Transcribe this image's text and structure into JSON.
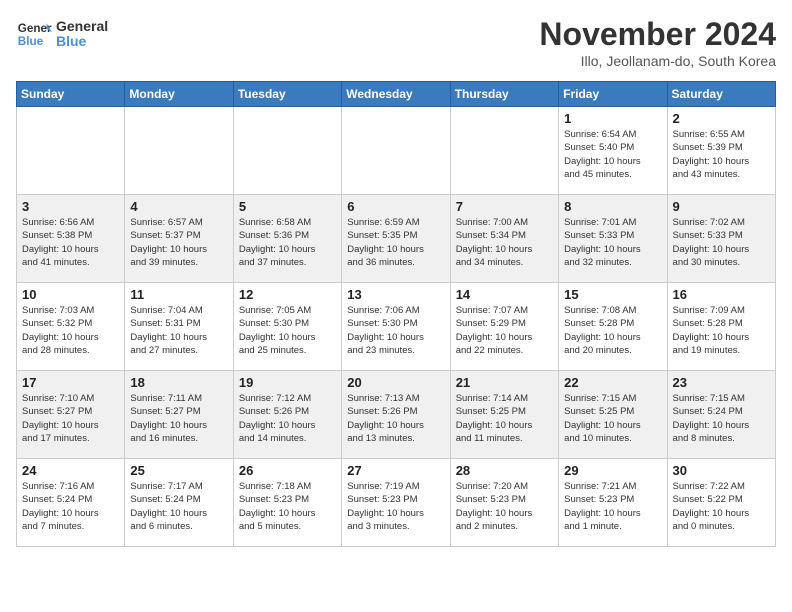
{
  "header": {
    "logo_line1": "General",
    "logo_line2": "Blue",
    "month": "November 2024",
    "location": "Illo, Jeollanam-do, South Korea"
  },
  "weekdays": [
    "Sunday",
    "Monday",
    "Tuesday",
    "Wednesday",
    "Thursday",
    "Friday",
    "Saturday"
  ],
  "weeks": [
    [
      {
        "day": "",
        "info": ""
      },
      {
        "day": "",
        "info": ""
      },
      {
        "day": "",
        "info": ""
      },
      {
        "day": "",
        "info": ""
      },
      {
        "day": "",
        "info": ""
      },
      {
        "day": "1",
        "info": "Sunrise: 6:54 AM\nSunset: 5:40 PM\nDaylight: 10 hours\nand 45 minutes."
      },
      {
        "day": "2",
        "info": "Sunrise: 6:55 AM\nSunset: 5:39 PM\nDaylight: 10 hours\nand 43 minutes."
      }
    ],
    [
      {
        "day": "3",
        "info": "Sunrise: 6:56 AM\nSunset: 5:38 PM\nDaylight: 10 hours\nand 41 minutes."
      },
      {
        "day": "4",
        "info": "Sunrise: 6:57 AM\nSunset: 5:37 PM\nDaylight: 10 hours\nand 39 minutes."
      },
      {
        "day": "5",
        "info": "Sunrise: 6:58 AM\nSunset: 5:36 PM\nDaylight: 10 hours\nand 37 minutes."
      },
      {
        "day": "6",
        "info": "Sunrise: 6:59 AM\nSunset: 5:35 PM\nDaylight: 10 hours\nand 36 minutes."
      },
      {
        "day": "7",
        "info": "Sunrise: 7:00 AM\nSunset: 5:34 PM\nDaylight: 10 hours\nand 34 minutes."
      },
      {
        "day": "8",
        "info": "Sunrise: 7:01 AM\nSunset: 5:33 PM\nDaylight: 10 hours\nand 32 minutes."
      },
      {
        "day": "9",
        "info": "Sunrise: 7:02 AM\nSunset: 5:33 PM\nDaylight: 10 hours\nand 30 minutes."
      }
    ],
    [
      {
        "day": "10",
        "info": "Sunrise: 7:03 AM\nSunset: 5:32 PM\nDaylight: 10 hours\nand 28 minutes."
      },
      {
        "day": "11",
        "info": "Sunrise: 7:04 AM\nSunset: 5:31 PM\nDaylight: 10 hours\nand 27 minutes."
      },
      {
        "day": "12",
        "info": "Sunrise: 7:05 AM\nSunset: 5:30 PM\nDaylight: 10 hours\nand 25 minutes."
      },
      {
        "day": "13",
        "info": "Sunrise: 7:06 AM\nSunset: 5:30 PM\nDaylight: 10 hours\nand 23 minutes."
      },
      {
        "day": "14",
        "info": "Sunrise: 7:07 AM\nSunset: 5:29 PM\nDaylight: 10 hours\nand 22 minutes."
      },
      {
        "day": "15",
        "info": "Sunrise: 7:08 AM\nSunset: 5:28 PM\nDaylight: 10 hours\nand 20 minutes."
      },
      {
        "day": "16",
        "info": "Sunrise: 7:09 AM\nSunset: 5:28 PM\nDaylight: 10 hours\nand 19 minutes."
      }
    ],
    [
      {
        "day": "17",
        "info": "Sunrise: 7:10 AM\nSunset: 5:27 PM\nDaylight: 10 hours\nand 17 minutes."
      },
      {
        "day": "18",
        "info": "Sunrise: 7:11 AM\nSunset: 5:27 PM\nDaylight: 10 hours\nand 16 minutes."
      },
      {
        "day": "19",
        "info": "Sunrise: 7:12 AM\nSunset: 5:26 PM\nDaylight: 10 hours\nand 14 minutes."
      },
      {
        "day": "20",
        "info": "Sunrise: 7:13 AM\nSunset: 5:26 PM\nDaylight: 10 hours\nand 13 minutes."
      },
      {
        "day": "21",
        "info": "Sunrise: 7:14 AM\nSunset: 5:25 PM\nDaylight: 10 hours\nand 11 minutes."
      },
      {
        "day": "22",
        "info": "Sunrise: 7:15 AM\nSunset: 5:25 PM\nDaylight: 10 hours\nand 10 minutes."
      },
      {
        "day": "23",
        "info": "Sunrise: 7:15 AM\nSunset: 5:24 PM\nDaylight: 10 hours\nand 8 minutes."
      }
    ],
    [
      {
        "day": "24",
        "info": "Sunrise: 7:16 AM\nSunset: 5:24 PM\nDaylight: 10 hours\nand 7 minutes."
      },
      {
        "day": "25",
        "info": "Sunrise: 7:17 AM\nSunset: 5:24 PM\nDaylight: 10 hours\nand 6 minutes."
      },
      {
        "day": "26",
        "info": "Sunrise: 7:18 AM\nSunset: 5:23 PM\nDaylight: 10 hours\nand 5 minutes."
      },
      {
        "day": "27",
        "info": "Sunrise: 7:19 AM\nSunset: 5:23 PM\nDaylight: 10 hours\nand 3 minutes."
      },
      {
        "day": "28",
        "info": "Sunrise: 7:20 AM\nSunset: 5:23 PM\nDaylight: 10 hours\nand 2 minutes."
      },
      {
        "day": "29",
        "info": "Sunrise: 7:21 AM\nSunset: 5:23 PM\nDaylight: 10 hours\nand 1 minute."
      },
      {
        "day": "30",
        "info": "Sunrise: 7:22 AM\nSunset: 5:22 PM\nDaylight: 10 hours\nand 0 minutes."
      }
    ]
  ]
}
